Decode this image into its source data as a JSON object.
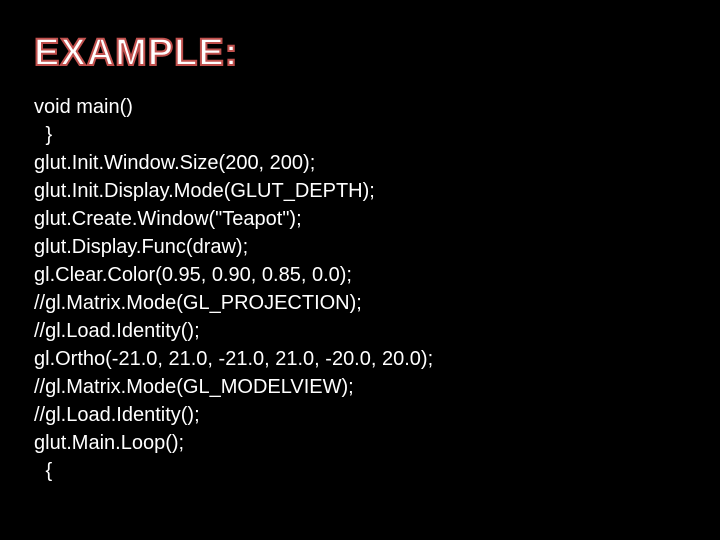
{
  "heading": "EXAMPLE:",
  "code": {
    "l1": "void main()",
    "l2": " }",
    "l3": "glut.Init.Window.Size(200, 200);",
    "l4": "glut.Init.Display.Mode(GLUT_DEPTH);",
    "l5": "glut.Create.Window(\"Teapot\");",
    "l6": "glut.Display.Func(draw);",
    "l7": "gl.Clear.Color(0.95, 0.90, 0.85, 0.0);",
    "l8": "//gl.Matrix.Mode(GL_PROJECTION);",
    "l9": "//gl.Load.Identity();",
    "l10": "gl.Ortho(-21.0, 21.0, -21.0, 21.0, -20.0, 20.0);",
    "l11": "//gl.Matrix.Mode(GL_MODELVIEW);",
    "l12": "//gl.Load.Identity();",
    "l13": "glut.Main.Loop();",
    "l14": " {"
  }
}
